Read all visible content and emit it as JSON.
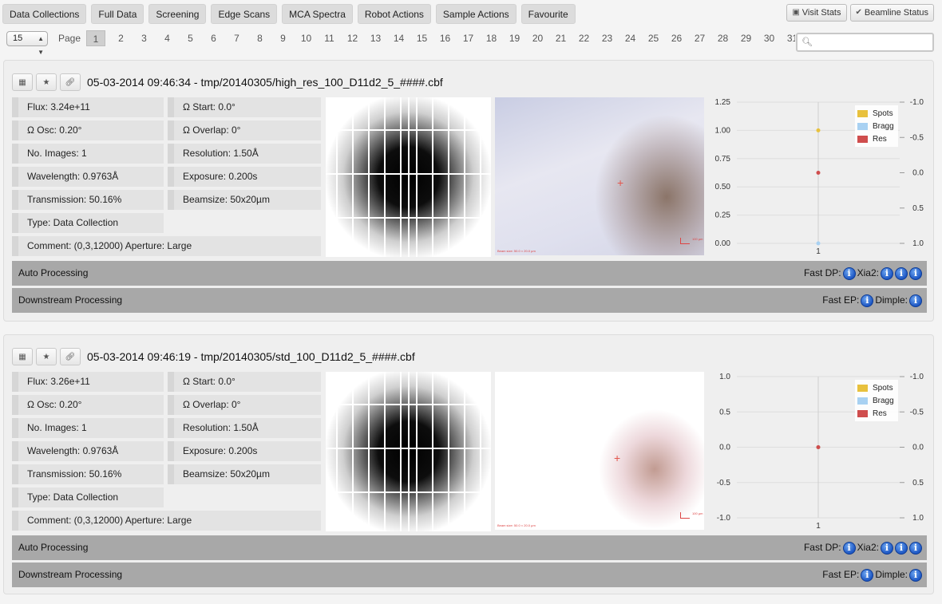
{
  "nav": {
    "tabs": [
      "Data Collections",
      "Full Data",
      "Screening",
      "Edge Scans",
      "MCA Spectra",
      "Robot Actions",
      "Sample Actions",
      "Favourite"
    ],
    "visit_stats": "Visit Stats",
    "beamline_status": "Beamline Status"
  },
  "pager": {
    "per_page": "15",
    "label": "Page",
    "pages": [
      "1",
      "2",
      "3",
      "4",
      "5",
      "6",
      "7",
      "8",
      "9",
      "10",
      "11",
      "12",
      "13",
      "14",
      "15",
      "16",
      "17",
      "18",
      "19",
      "20",
      "21",
      "22",
      "23",
      "24",
      "25",
      "26",
      "27",
      "28",
      "29",
      "30",
      "31"
    ],
    "current": "1",
    "search_value": ""
  },
  "collections": [
    {
      "title": "05-03-2014 09:46:34 - tmp/20140305/high_res_100_D11d2_5_####.cbf",
      "flux": "Flux: 3.24e+11",
      "omega_start": "Ω Start: 0.0°",
      "omega_osc": "Ω Osc: 0.20°",
      "omega_overlap": "Ω Overlap: 0°",
      "num_images": "No. Images: 1",
      "resolution": "Resolution: 1.50Å",
      "wavelength": "Wavelength: 0.9763Å",
      "exposure": "Exposure: 0.200s",
      "transmission": "Transmission: 50.16%",
      "beamsize": "Beamsize: 50x20µm",
      "type": "Type: Data Collection",
      "comment": "Comment:  (0,3,12000) Aperture: Large",
      "auto_processing": "Auto Processing",
      "fast_dp": "Fast DP:",
      "xia2": "Xia2:",
      "downstream_processing": "Downstream Processing",
      "fast_ep": "Fast EP:",
      "dimple": "Dimple:",
      "snapshot_scale": "100 µm",
      "snapshot_caption": "Beam size: 50.0 × 20.0 µm",
      "chart_data": {
        "type": "scatter",
        "categories": [
          "1"
        ],
        "y_left_ticks": [
          "1.25",
          "1.00",
          "0.75",
          "0.50",
          "0.25",
          "0.00"
        ],
        "y_left_range": [
          0,
          1.25
        ],
        "y_right_ticks": [
          "-1.0",
          "-0.5",
          "0.0",
          "0.5",
          "1.0"
        ],
        "y_right_range": [
          -1.0,
          1.0
        ],
        "y_right_inverted": true,
        "grid": true,
        "legend_position": "top-right",
        "series": [
          {
            "name": "Spots",
            "color": "#e8c13d",
            "axis": "left",
            "values": [
              1.0
            ]
          },
          {
            "name": "Bragg",
            "color": "#a8d1f2",
            "axis": "left",
            "values": [
              0.0
            ]
          },
          {
            "name": "Res",
            "color": "#cf4d4d",
            "axis": "right",
            "values": [
              0.0
            ]
          }
        ]
      }
    },
    {
      "title": "05-03-2014 09:46:19 - tmp/20140305/std_100_D11d2_5_####.cbf",
      "flux": "Flux: 3.26e+11",
      "omega_start": "Ω Start: 0.0°",
      "omega_osc": "Ω Osc: 0.20°",
      "omega_overlap": "Ω Overlap: 0°",
      "num_images": "No. Images: 1",
      "resolution": "Resolution: 1.50Å",
      "wavelength": "Wavelength: 0.9763Å",
      "exposure": "Exposure: 0.200s",
      "transmission": "Transmission: 50.16%",
      "beamsize": "Beamsize: 50x20µm",
      "type": "Type: Data Collection",
      "comment": "Comment:  (0,3,12000) Aperture: Large",
      "auto_processing": "Auto Processing",
      "fast_dp": "Fast DP:",
      "xia2": "Xia2:",
      "downstream_processing": "Downstream Processing",
      "fast_ep": "Fast EP:",
      "dimple": "Dimple:",
      "snapshot_scale": "100 µm",
      "snapshot_caption": "Beam size: 50.0 × 20.0 µm",
      "chart_data": {
        "type": "scatter",
        "categories": [
          "1"
        ],
        "y_left_ticks": [
          "1.0",
          "0.5",
          "0.0",
          "-0.5",
          "-1.0"
        ],
        "y_left_range": [
          -1.0,
          1.0
        ],
        "y_right_ticks": [
          "-1.0",
          "-0.5",
          "0.0",
          "0.5",
          "1.0"
        ],
        "y_right_range": [
          -1.0,
          1.0
        ],
        "y_right_inverted": true,
        "grid": true,
        "legend_position": "top-right",
        "series": [
          {
            "name": "Spots",
            "color": "#e8c13d",
            "axis": "left",
            "values": [
              0.0
            ]
          },
          {
            "name": "Bragg",
            "color": "#a8d1f2",
            "axis": "left",
            "values": [
              0.0
            ]
          },
          {
            "name": "Res",
            "color": "#cf4d4d",
            "axis": "right",
            "values": [
              0.0
            ]
          }
        ]
      }
    }
  ]
}
